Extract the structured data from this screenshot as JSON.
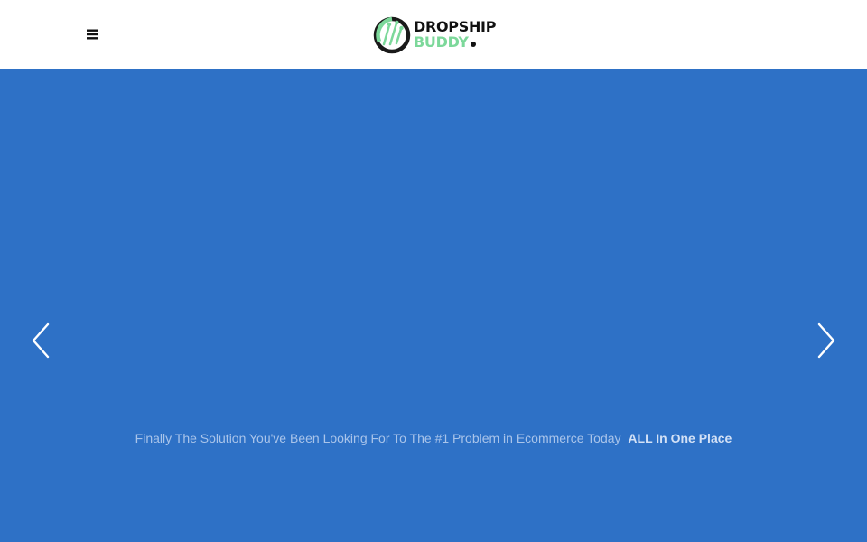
{
  "header": {
    "menu_icon": "hamburger-menu-icon",
    "logo": {
      "line1": "DROPSHIP",
      "line2": "BUDDY",
      "colors": {
        "ring": "#1a1a1a",
        "accent": "#7cd89a"
      }
    }
  },
  "hero": {
    "background_color": "#2e71c6",
    "prev_icon": "chevron-left-icon",
    "next_icon": "chevron-right-icon",
    "tagline": {
      "text": "Finally The Solution You've Been Looking For To The #1 Problem in Ecommerce Today",
      "emphasis": "ALL In One Place"
    }
  }
}
